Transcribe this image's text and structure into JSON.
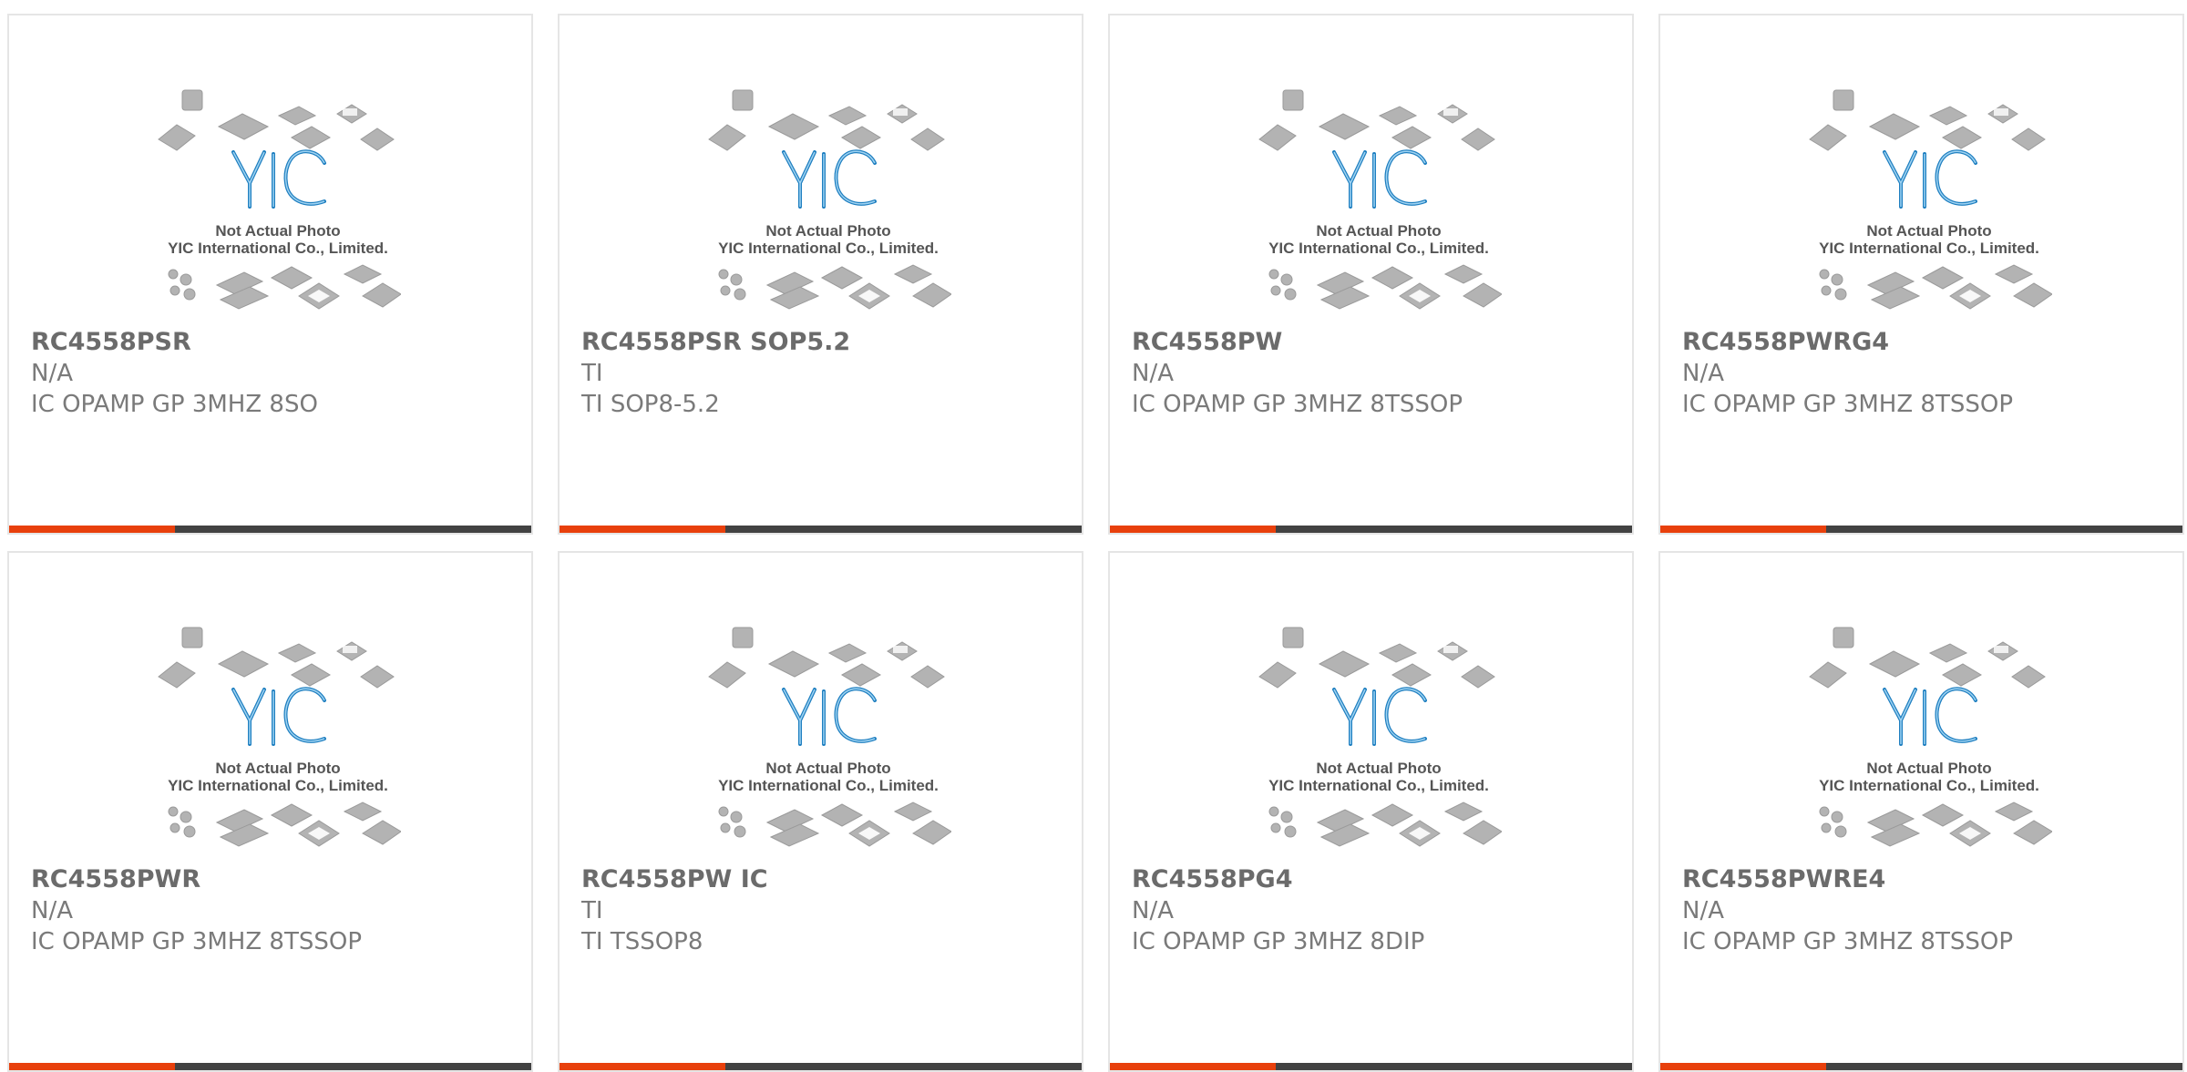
{
  "placeholder": {
    "logo_text": "YIC",
    "line1": "Not Actual Photo",
    "line2": "YIC International Co., Limited."
  },
  "products": [
    {
      "part": "RC4558PSR",
      "brand": "N/A",
      "desc": "IC OPAMP GP 3MHZ 8SO"
    },
    {
      "part": "RC4558PSR SOP5.2",
      "brand": "TI",
      "desc": "TI SOP8-5.2"
    },
    {
      "part": "RC4558PW",
      "brand": "N/A",
      "desc": "IC OPAMP GP 3MHZ 8TSSOP"
    },
    {
      "part": "RC4558PWRG4",
      "brand": "N/A",
      "desc": "IC OPAMP GP 3MHZ 8TSSOP"
    },
    {
      "part": "RC4558PWR",
      "brand": "N/A",
      "desc": "IC OPAMP GP 3MHZ 8TSSOP"
    },
    {
      "part": "RC4558PW IC",
      "brand": "TI",
      "desc": "TI TSSOP8"
    },
    {
      "part": "RC4558PG4",
      "brand": "N/A",
      "desc": "IC OPAMP GP 3MHZ 8DIP"
    },
    {
      "part": "RC4558PWRE4",
      "brand": "N/A",
      "desc": "IC OPAMP GP 3MHZ 8TSSOP"
    }
  ],
  "colors": {
    "accent": "#e8400c",
    "bar_dark": "#424242",
    "logo_blue": "#1f7fc0",
    "chip_gray": "#b3b3b3"
  }
}
